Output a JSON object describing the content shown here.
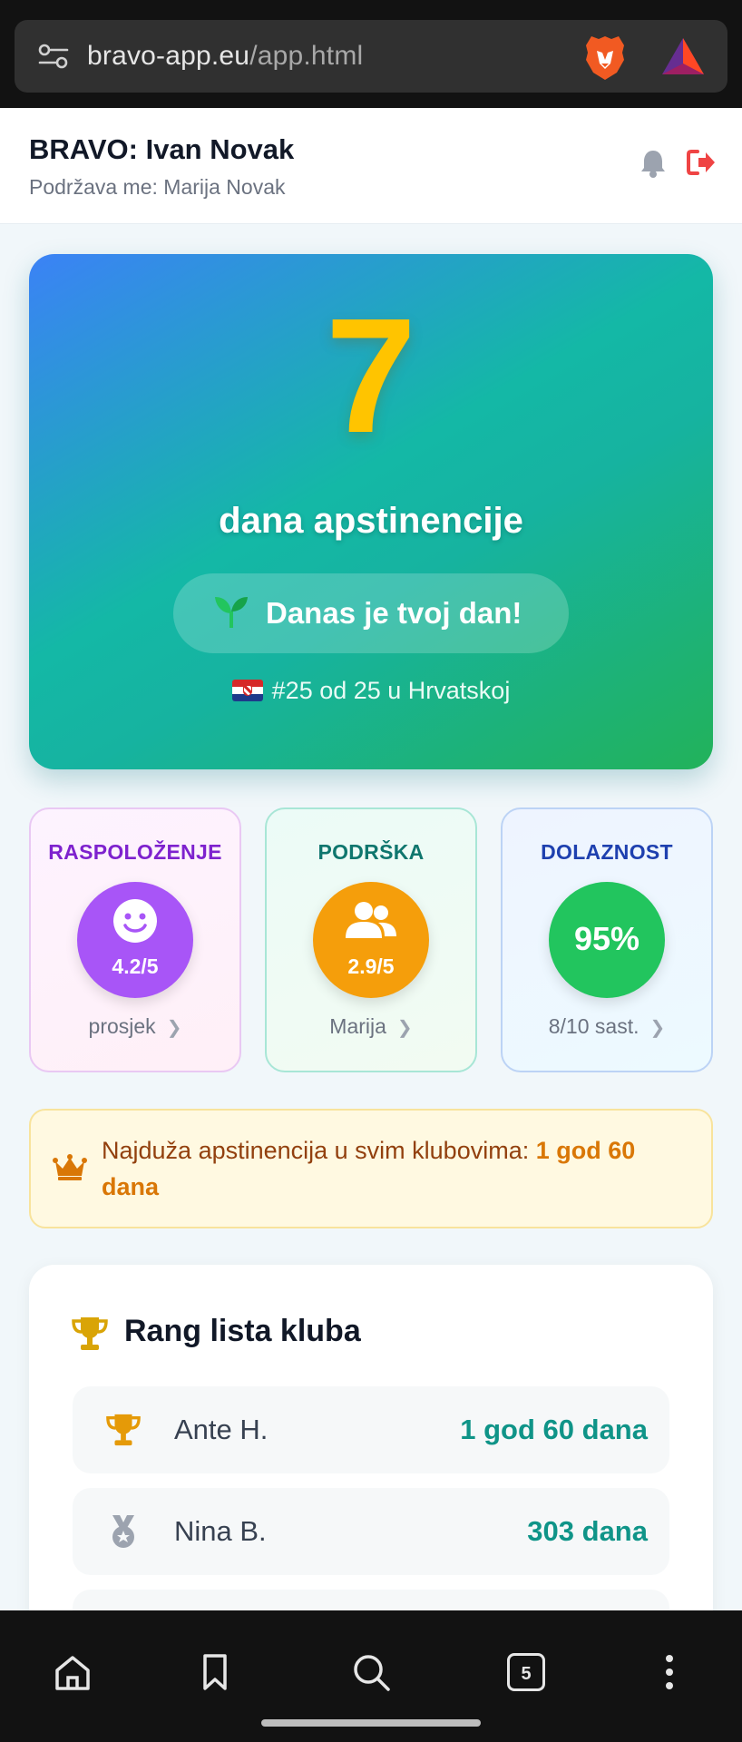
{
  "browser": {
    "url_host": "bravo-app.eu",
    "url_path": "/app.html",
    "tabs_count": "5"
  },
  "header": {
    "title": "BRAVO: Ivan Novak",
    "subtitle": "Podržava me: Marija Novak"
  },
  "hero": {
    "days": "7",
    "label": "dana apstinencije",
    "motto": "Danas je tvoj dan!",
    "rank": "#25 od 25 u Hrvatskoj"
  },
  "stats": {
    "mood": {
      "title": "RASPOLOŽENJE",
      "value": "4.2/5",
      "footer": "prosjek",
      "color": "#a855f7"
    },
    "support": {
      "title": "PODRŠKA",
      "value": "2.9/5",
      "footer": "Marija",
      "color": "#f59e0b"
    },
    "attendance": {
      "title": "DOLAZNOST",
      "value": "95%",
      "footer": "8/10 sast.",
      "color": "#22c55e"
    }
  },
  "banner": {
    "text": "Najduža apstinencija u svim klubovima: ",
    "highlight": "1 god 60 dana"
  },
  "leaderboard": {
    "title": "Rang lista kluba",
    "rows": [
      {
        "icon": "trophy-gold-icon",
        "name": "Ante H.",
        "value": "1 god 60 dana"
      },
      {
        "icon": "medal-silver-icon",
        "name": "Nina B.",
        "value": "303 dana"
      }
    ]
  },
  "colors": {
    "accent_teal": "#0f9488",
    "gold": "#ffc400",
    "logout_red": "#ef4444"
  }
}
